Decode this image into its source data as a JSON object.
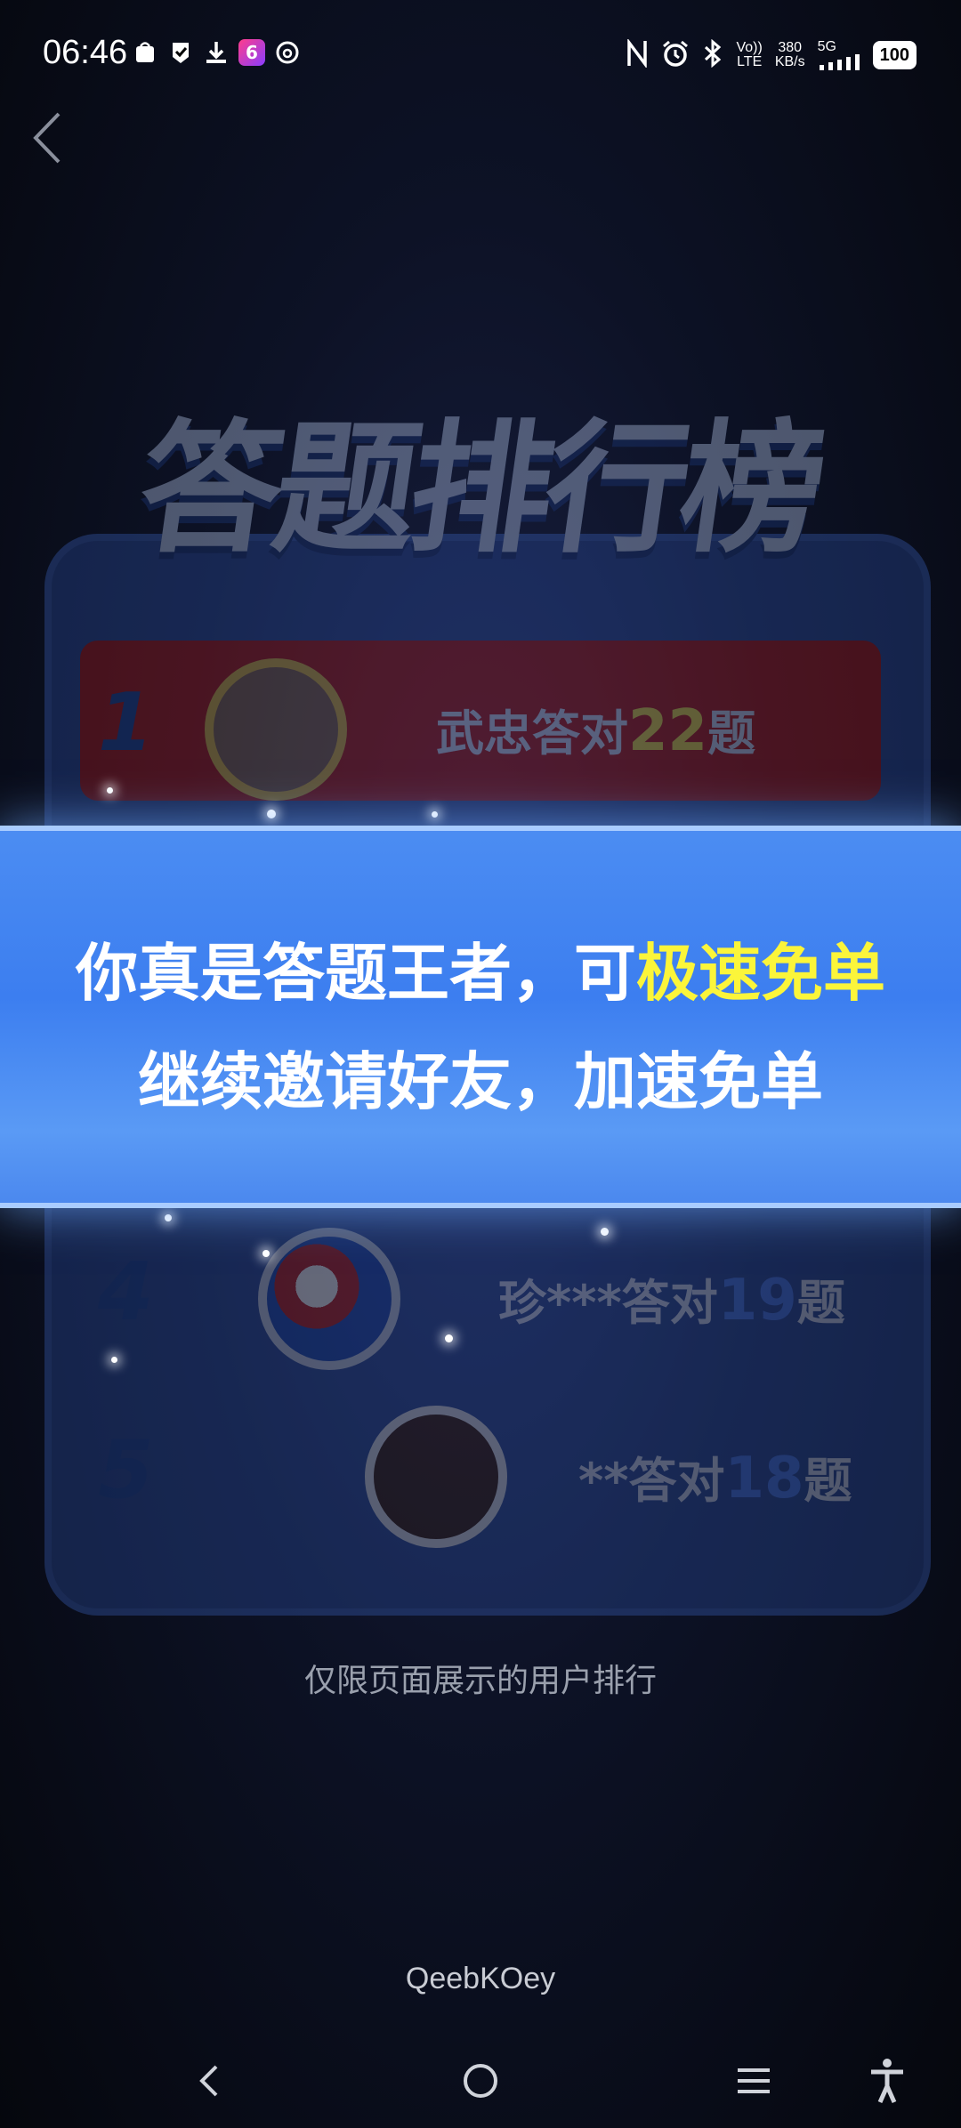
{
  "status_bar": {
    "time": "06:46",
    "left_icons": [
      "shopping-icon",
      "shield-check-icon",
      "download-icon",
      "app-6-icon",
      "threads-icon"
    ],
    "app_badge": "6",
    "speed_value": "380",
    "speed_unit": "KB/s",
    "network_top": "Vo))",
    "network_bottom": "LTE",
    "signal_label": "5G",
    "battery": "100"
  },
  "leaderboard": {
    "title": "答题排行榜",
    "rows": [
      {
        "rank": "1",
        "name": "武忠答对",
        "count": "22",
        "suffix": "题"
      },
      {
        "rank": "4",
        "name": "珍***答对",
        "count": "19",
        "suffix": "题"
      },
      {
        "rank": "5",
        "name": "**答对",
        "count": "18",
        "suffix": "题"
      }
    ],
    "hint": "仅限页面展示的用户排行"
  },
  "banner": {
    "line1_prefix": "你真是答题王者，可",
    "line1_highlight": "极速免单",
    "line2": "继续邀请好友，加速免单",
    "highlight_color": "#fbf53a",
    "accent_color": "#4c8df2"
  },
  "watermark": "QeebKOey",
  "nav": {
    "icons": [
      "back-icon",
      "home-icon",
      "menu-icon",
      "accessibility-icon"
    ]
  }
}
